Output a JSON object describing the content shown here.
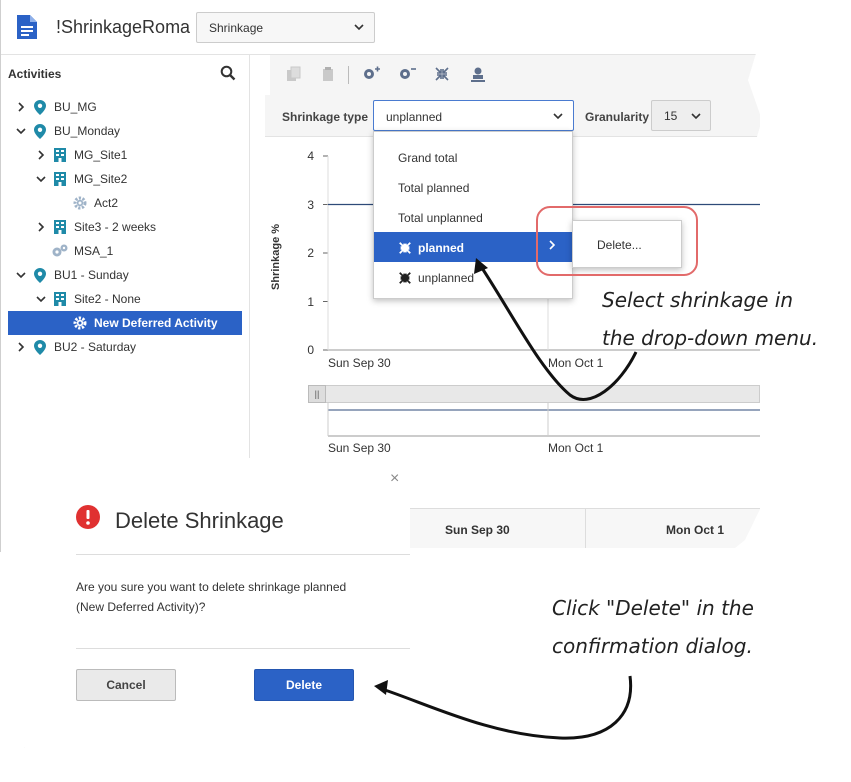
{
  "app": {
    "title": "!ShrinkageRoma",
    "view_select": "Shrinkage"
  },
  "sidebar": {
    "heading": "Activities",
    "tree": [
      {
        "label": "BU_MG",
        "level": 0,
        "type": "bu",
        "expanded": false
      },
      {
        "label": "BU_Monday",
        "level": 0,
        "type": "bu",
        "expanded": true
      },
      {
        "label": "MG_Site1",
        "level": 1,
        "type": "site",
        "expanded": false
      },
      {
        "label": "MG_Site2",
        "level": 1,
        "type": "site",
        "expanded": true
      },
      {
        "label": "Act2",
        "level": 2,
        "type": "activity"
      },
      {
        "label": "Site3 - 2 weeks",
        "level": 1,
        "type": "site",
        "expanded": false
      },
      {
        "label": "MSA_1",
        "level": 1,
        "type": "multi-site-activity"
      },
      {
        "label": "BU1 - Sunday",
        "level": 0,
        "type": "bu",
        "expanded": true
      },
      {
        "label": "Site2 - None",
        "level": 1,
        "type": "site",
        "expanded": true
      },
      {
        "label": "New Deferred Activity",
        "level": 2,
        "type": "activity",
        "selected": true
      },
      {
        "label": "BU2 - Saturday",
        "level": 0,
        "type": "bu",
        "expanded": false
      }
    ]
  },
  "filters": {
    "type_label": "Shrinkage type",
    "type_value": "unplanned",
    "granularity_label": "Granularity",
    "granularity_value": "15"
  },
  "dropdown": {
    "items": [
      "Grand total",
      "Total planned",
      "Total unplanned",
      "planned",
      "unplanned"
    ],
    "active_item": "planned",
    "submenu_item": "Delete..."
  },
  "chart_data": {
    "type": "line",
    "ylabel": "Shrinkage %",
    "ylim": [
      0,
      4
    ],
    "yticks": [
      "4",
      "3",
      "2",
      "1",
      "0"
    ],
    "x": [
      "Sun Sep 30",
      "Mon Oct 1"
    ],
    "series": [
      {
        "values": [
          3,
          3
        ]
      }
    ],
    "navigator_ticks": [
      "Sun Sep 30",
      "Mon Oct 1"
    ]
  },
  "grid": {
    "columns": [
      "Sun Sep 30",
      "Mon Oct 1"
    ]
  },
  "dialog": {
    "close": "×",
    "title": "Delete Shrinkage",
    "message_line1": "Are you sure you want to delete shrinkage planned",
    "message_line2": "(New Deferred Activity)?",
    "cancel_label": "Cancel",
    "delete_label": "Delete"
  },
  "callouts": {
    "first_line1": "Select shrinkage  in",
    "first_line2": "the drop-down menu.",
    "second_line1": "Click \"Delete\" in the",
    "second_line2": "confirmation dialog."
  },
  "colors": {
    "primary": "#2b62c6",
    "tree_icon": "#1f8aa8",
    "alert": "#e03131",
    "highlight": "#e26a6a"
  }
}
